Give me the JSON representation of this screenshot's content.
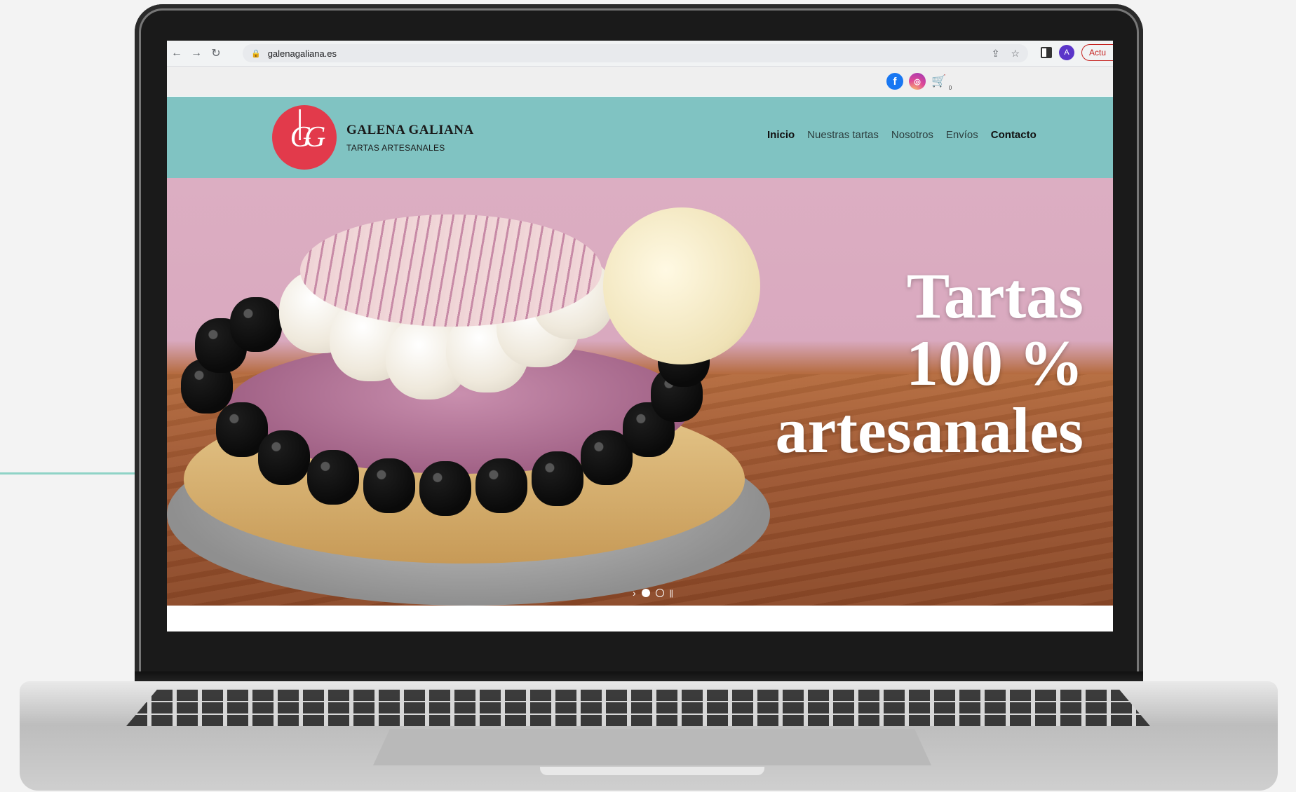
{
  "browser": {
    "url": "galenagaliana.es",
    "update_label": "Actu",
    "avatar_letter": "A"
  },
  "topbar": {
    "cart_count": "0"
  },
  "header": {
    "brand_name": "GALENA GALIANA",
    "brand_tagline": "TARTAS ARTESANALES",
    "nav": [
      "Inicio",
      "Nuestras tartas",
      "Nosotros",
      "Envíos",
      "Contacto"
    ]
  },
  "hero": {
    "line1": "Tartas",
    "line2": "100 %",
    "line3": "artesanales",
    "active_slide": 1,
    "total_slides": 2
  },
  "colors": {
    "header_bg": "#80c3c2",
    "logo_red": "#e23a4b",
    "accent_line": "#8fd3c6"
  }
}
